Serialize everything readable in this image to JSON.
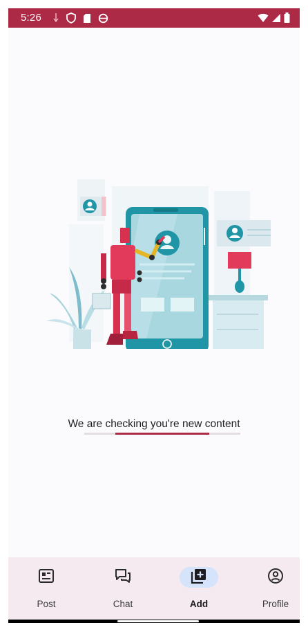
{
  "status_bar": {
    "time": "5:26",
    "color": "#ad2a47",
    "left_icons": [
      "usb-icon",
      "shield-icon",
      "sd-card-icon",
      "sync-icon"
    ],
    "right_icons": [
      "wifi-icon",
      "signal-icon",
      "battery-icon"
    ]
  },
  "illustration": {
    "description_icons": [
      "robot",
      "smartphone",
      "profile-card",
      "plant",
      "lamp",
      "drawer"
    ]
  },
  "loading": {
    "message": "We are checking you're new content",
    "progress_fraction": 0.6,
    "accent": "#ad2a47"
  },
  "bottom_nav": {
    "items": [
      {
        "label": "Post",
        "icon": "post-icon",
        "active": false
      },
      {
        "label": "Chat",
        "icon": "chat-icon",
        "active": false
      },
      {
        "label": "Add",
        "icon": "add-library-icon",
        "active": true
      },
      {
        "label": "Profile",
        "icon": "profile-icon",
        "active": false
      }
    ],
    "active_pill_color": "#d5e4fa"
  }
}
